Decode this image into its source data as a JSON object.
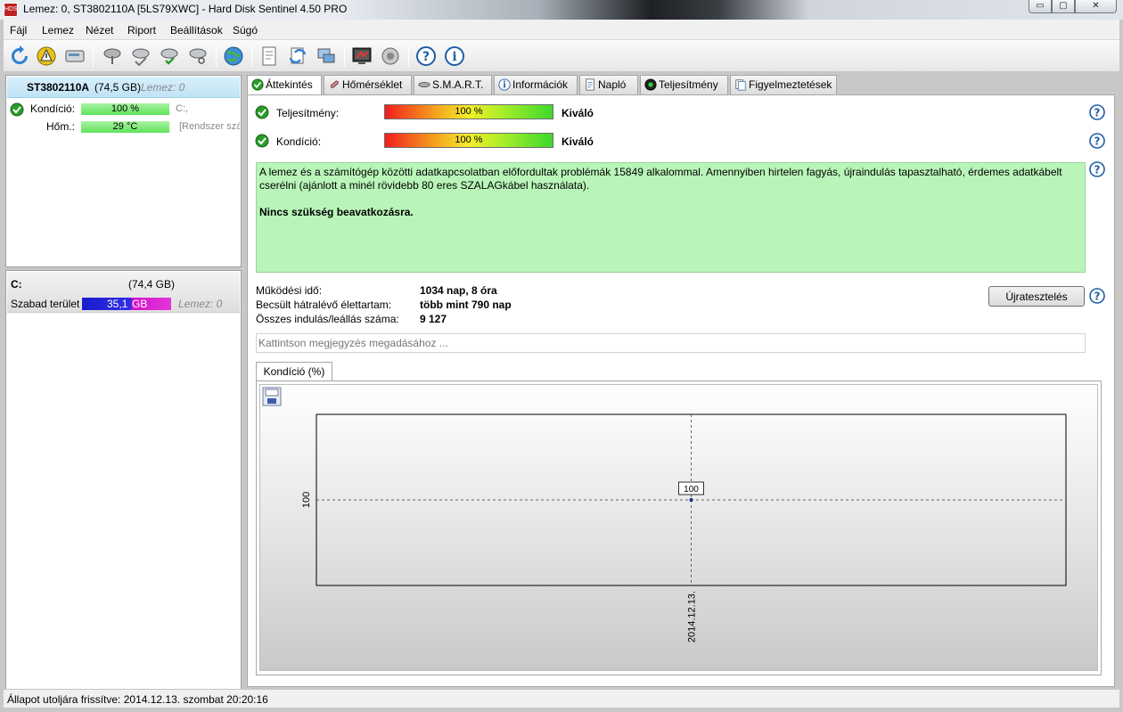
{
  "window": {
    "title": "Lemez: 0, ST3802110A [5LS79XWC]  -  Hard Disk Sentinel 4.50 PRO",
    "min": "▭",
    "max": "▢",
    "close": "✕"
  },
  "menu": {
    "items": [
      {
        "label": "Fájl"
      },
      {
        "label": "Lemez"
      },
      {
        "label": "Nézet"
      },
      {
        "label": "Riport"
      },
      {
        "label": "Beállítások"
      },
      {
        "label": "Súgó"
      }
    ]
  },
  "disk": {
    "name": "ST3802110A",
    "size": "(74,5 GB)",
    "lemez": "Lemez: 0",
    "condition_label": "Kondíció:",
    "condition_value": "100 %",
    "condition_percent": 100,
    "condition_extra": "C:,",
    "temp_label": "Hőm.:",
    "temp_value": "29 °C",
    "temp_extra": "[Rendszer szá"
  },
  "volume": {
    "drive": "C:",
    "size": "(74,4 GB)",
    "free_label": "Szabad terület",
    "free_value": "35,1",
    "free_unit": "GB",
    "lemez": "Lemez: 0"
  },
  "tabs": [
    {
      "label": "Áttekintés",
      "active": true
    },
    {
      "label": "Hőmérséklet",
      "active": false
    },
    {
      "label": "S.M.A.R.T.",
      "active": false
    },
    {
      "label": "Információk",
      "active": false
    },
    {
      "label": "Napló",
      "active": false
    },
    {
      "label": "Teljesítmény",
      "active": false
    },
    {
      "label": "Figyelmeztetések",
      "active": false
    }
  ],
  "overview": {
    "performance_label": "Teljesítmény:",
    "performance_value": "100 %",
    "performance_percent": 100,
    "performance_word": "Kiváló",
    "health_label": "Kondíció:",
    "health_value": "100 %",
    "health_percent": 100,
    "health_word": "Kiváló",
    "message": "A lemez és a számítógép közötti adatkapcsolatban előfordultak problémák 15849 alkalommal. Amennyiben hirtelen fagyás, újraindulás tapasztalható, érdemes adatkábelt cserélni (ajánlott a minél rövidebb 80 eres SZALAGkábel használata).",
    "message_bold": "Nincs szükség beavatkozásra.",
    "power_on_label": "Működési idő:",
    "power_on_value": "1034 nap, 8 óra",
    "lifetime_label": "Becsült hátralévő élettartam:",
    "lifetime_value": "több mint 790 nap",
    "startstop_label": "Összes indulás/leállás száma:",
    "startstop_value": "9 127",
    "retest_button": "Újratesztelés",
    "note_placeholder": "Kattintson megjegyzés megadásához ..."
  },
  "chart_tab": "Kondíció  (%)",
  "chart_data": {
    "type": "line",
    "x": [
      "2014.12.13."
    ],
    "series": [
      {
        "values": [
          100
        ]
      }
    ],
    "yticks": [
      "100"
    ],
    "data_labels": [
      "100"
    ],
    "grid": true,
    "title": "",
    "xlabel": "",
    "ylabel": ""
  },
  "status": {
    "text": "Állapot utoljára frissítve: 2014.12.13. szombat 20:20:16"
  },
  "colors": {
    "green_ok": "#2a9d2a",
    "message_bg": "#b9f5b9",
    "header_blue": "#bfe3f5",
    "free_blue": "#2e2ee8",
    "free_magenta": "#d013c9"
  }
}
